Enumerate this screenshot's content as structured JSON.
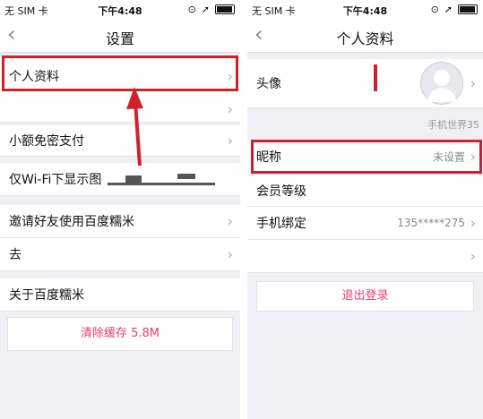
{
  "left": {
    "status": {
      "carrier": "无 SIM 卡",
      "time": "下午4:48"
    },
    "title": "设置",
    "rows": {
      "profile": "个人资料",
      "petty_pay": "小额免密支付",
      "wifi_images": "仅Wi-Fi下显示图",
      "invite": "邀请好友使用百度糯米",
      "go": "去",
      "about": "关于百度糯米"
    },
    "clear_cache": "清除缓存 5.8M"
  },
  "right": {
    "status": {
      "carrier": "无 SIM 卡",
      "time": "下午4:48"
    },
    "title": "个人资料",
    "rows": {
      "avatar": "头像",
      "source_label": "手机世界35",
      "nickname": "昵称",
      "nickname_value": "未设置",
      "member_level": "会员等级",
      "phone_bind": "手机绑定",
      "phone_value": "135*****275"
    },
    "logout": "退出登录"
  },
  "colors": {
    "highlight": "#d0202a",
    "accent": "#e0407a"
  }
}
